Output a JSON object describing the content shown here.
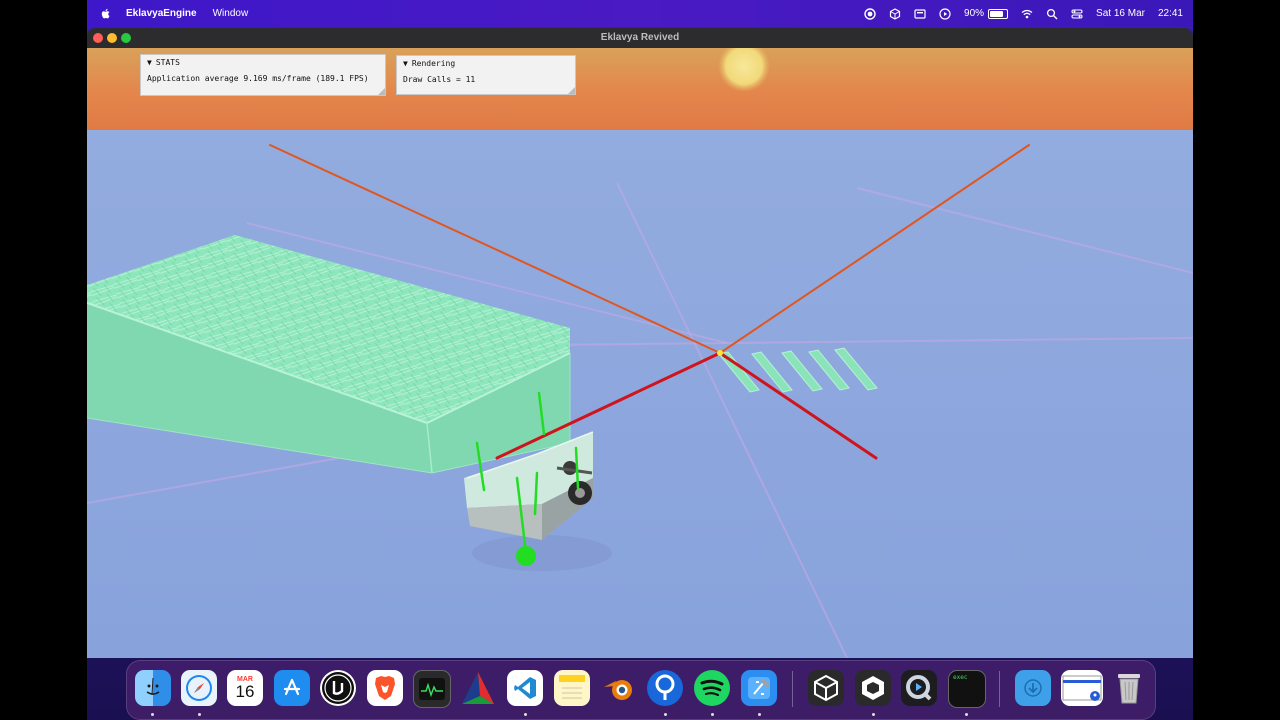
{
  "menubar": {
    "app_name": "EklavyaEngine",
    "menu_window": "Window",
    "battery_percent": "90%",
    "battery_level": 0.9,
    "date": "Sat 16 Mar",
    "time": "22:41",
    "icons": [
      "apple-icon",
      "screen-record-icon",
      "unity-hub-icon",
      "display-icon",
      "play-icon",
      "wifi-icon",
      "spotlight-icon",
      "control-center-icon"
    ]
  },
  "window": {
    "title": "Eklavya Revived"
  },
  "stats_panel": {
    "header": "STATS",
    "line": "Application average 9.169 ms/frame (189.1 FPS)"
  },
  "rendering_panel": {
    "header": "Rendering",
    "line": "Draw Calls = 11"
  },
  "colors": {
    "sky_top": "#d9a15a",
    "sky_horizon": "#e07a45",
    "ground": "#8ea6dc",
    "terrain": "#8be8bc",
    "axis_red": "#d0141c",
    "axis_orange": "#e0561f",
    "gizmo_green": "#22dd22"
  },
  "dock": {
    "calendar_month": "MAR",
    "calendar_day": "16",
    "terminal_label": "exec",
    "apps": [
      {
        "name": "finder-icon",
        "color": "#2f8fe8"
      },
      {
        "name": "safari-icon",
        "color": "#e9f3fb"
      },
      {
        "name": "calendar-icon",
        "color": "#ffffff"
      },
      {
        "name": "app-store-icon",
        "color": "#1f8cf0"
      },
      {
        "name": "unreal-engine-icon",
        "color": "#0f0f0f"
      },
      {
        "name": "brave-icon",
        "color": "#fb542b"
      },
      {
        "name": "activity-monitor-icon",
        "color": "#2a2a2a"
      },
      {
        "name": "cmake-icon",
        "color": "#1e3c8c"
      },
      {
        "name": "vscode-icon",
        "color": "#ffffff"
      },
      {
        "name": "notes-icon",
        "color": "#fff6c8"
      },
      {
        "name": "blender-icon",
        "color": "#e87d0d"
      },
      {
        "name": "sourcetree-icon",
        "color": "#1868db"
      },
      {
        "name": "spotify-icon",
        "color": "#1ed760"
      },
      {
        "name": "xcode-icon",
        "color": "#2b8ef0"
      },
      {
        "name": "unity-icon",
        "color": "#2a2a2a"
      },
      {
        "name": "unity-hub-icon",
        "color": "#2a2a2a"
      },
      {
        "name": "quicktime-icon",
        "color": "#1d1d1f"
      },
      {
        "name": "terminal-icon",
        "color": "#111111"
      },
      {
        "name": "downloads-folder-icon",
        "color": "#3ea0e8"
      },
      {
        "name": "screen-share-icon",
        "color": "#ffffff"
      },
      {
        "name": "trash-icon",
        "color": "#c8c8c8"
      }
    ]
  }
}
